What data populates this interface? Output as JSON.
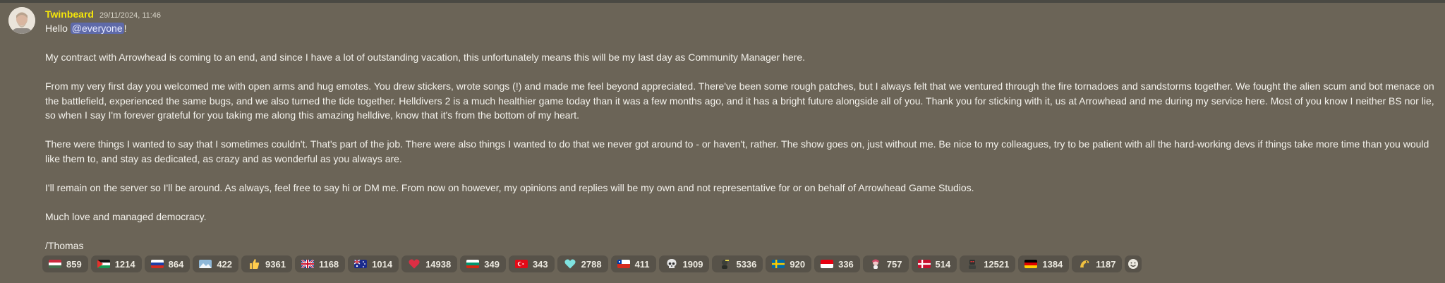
{
  "message": {
    "username": "Twinbeard",
    "timestamp": "29/11/2024, 11:46",
    "greeting_prefix": "Hello ",
    "mention": "@everyone",
    "greeting_suffix": "!",
    "paragraphs": [
      "My contract with Arrowhead is coming to an end, and since I have a lot of outstanding vacation, this unfortunately means this will be my last day as Community Manager here.",
      "From my very first day you welcomed me with open arms and hug emotes. You drew stickers, wrote songs (!) and made me feel beyond appreciated. There've been some rough patches, but I always felt that we ventured through the fire tornadoes and sandstorms together. We fought the alien scum and bot menace on the battlefield, experienced the same bugs, and we also turned the tide together. Helldivers 2 is a much healthier game today than it was a few months ago, and it has a bright future alongside all of you. Thank you for sticking with it, us at Arrowhead and me during my service here. Most of you know I neither BS nor lie, so when I say I'm forever grateful for you taking me along this amazing helldive, know that it's from the bottom of my heart.",
      "There were things I wanted to say that I sometimes couldn't. That's part of the job. There were also things I wanted to do that we never got around to - or haven't, rather. The show goes on, just without me. Be nice to my colleagues, try to be patient with all the hard-working devs if things take more time than you would like them to, and stay as dedicated, as crazy and as wonderful as you always are.",
      "I'll remain on the server so I'll be around. As always, feel free to say hi or DM me. From now on however, my opinions and replies will be my own and not representative for or on behalf of Arrowhead Game Studios.",
      "Much love and managed democracy.",
      "/Thomas"
    ]
  },
  "reactions": [
    {
      "icon": "flag-hungary-icon",
      "count": "859"
    },
    {
      "icon": "flag-palestine-icon",
      "count": "1214"
    },
    {
      "icon": "flag-russia-icon",
      "count": "864"
    },
    {
      "icon": "snow-landscape-icon",
      "count": "422"
    },
    {
      "icon": "thumbs-up-icon",
      "count": "9361"
    },
    {
      "icon": "flag-uk-icon",
      "count": "1168"
    },
    {
      "icon": "flag-australia-icon",
      "count": "1014"
    },
    {
      "icon": "heart-icon",
      "count": "14938"
    },
    {
      "icon": "flag-bulgaria-icon",
      "count": "349"
    },
    {
      "icon": "flag-turkey-icon",
      "count": "343"
    },
    {
      "icon": "cyan-heart-icon",
      "count": "2788"
    },
    {
      "icon": "flag-chile-icon",
      "count": "411"
    },
    {
      "icon": "skull-icon",
      "count": "1909"
    },
    {
      "icon": "soldier-emote-icon",
      "count": "5336"
    },
    {
      "icon": "flag-sweden-icon",
      "count": "920"
    },
    {
      "icon": "flag-indonesia-icon",
      "count": "336"
    },
    {
      "icon": "character-emote-icon",
      "count": "757"
    },
    {
      "icon": "flag-denmark-icon",
      "count": "514"
    },
    {
      "icon": "robot-emote-icon",
      "count": "12521"
    },
    {
      "icon": "flag-germany-icon",
      "count": "1384"
    },
    {
      "icon": "wave-emote-icon",
      "count": "1187"
    }
  ],
  "add_reaction_icon": "smiley-add-icon"
}
